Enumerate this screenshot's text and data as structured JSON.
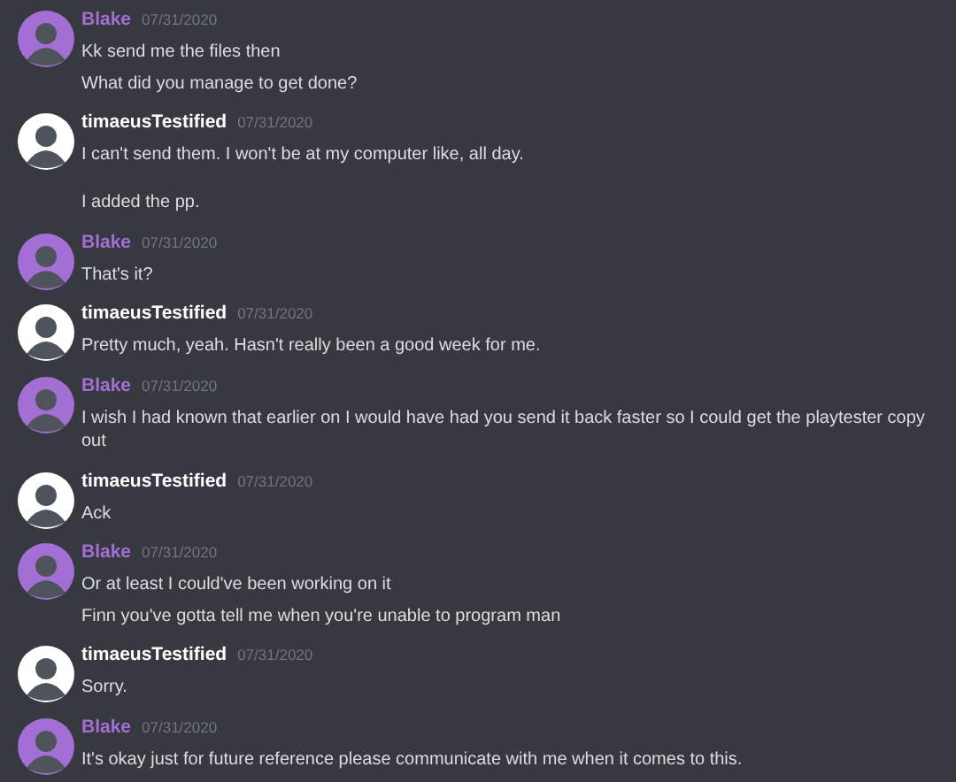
{
  "groups": [
    {
      "author": "Blake",
      "color": "#a46fd4",
      "date": "07/31/2020",
      "messages": [
        "Kk send me the files then",
        "What did you manage to get done?"
      ]
    },
    {
      "author": "timaeusTestified",
      "color": "#ffffff",
      "date": "07/31/2020",
      "messages": [
        "I can't send them. I won't be at my computer like, all day.\n\nI added the pp."
      ]
    },
    {
      "author": "Blake",
      "color": "#a46fd4",
      "date": "07/31/2020",
      "messages": [
        "That's it?"
      ]
    },
    {
      "author": "timaeusTestified",
      "color": "#ffffff",
      "date": "07/31/2020",
      "messages": [
        "Pretty much, yeah. Hasn't really been a good week for me."
      ]
    },
    {
      "author": "Blake",
      "color": "#a46fd4",
      "date": "07/31/2020",
      "messages": [
        "I wish I had known that earlier on I would have had you send it back faster so I could get the playtester copy out"
      ]
    },
    {
      "author": "timaeusTestified",
      "color": "#ffffff",
      "date": "07/31/2020",
      "messages": [
        "Ack"
      ]
    },
    {
      "author": "Blake",
      "color": "#a46fd4",
      "date": "07/31/2020",
      "messages": [
        "Or at least I could've been working on it",
        "Finn you've gotta tell me when you're unable to program man"
      ]
    },
    {
      "author": "timaeusTestified",
      "color": "#ffffff",
      "date": "07/31/2020",
      "messages": [
        "Sorry."
      ]
    },
    {
      "author": "Blake",
      "color": "#a46fd4",
      "date": "07/31/2020",
      "messages": [
        "It's okay just for future reference please communicate with me when it comes to this."
      ]
    }
  ]
}
